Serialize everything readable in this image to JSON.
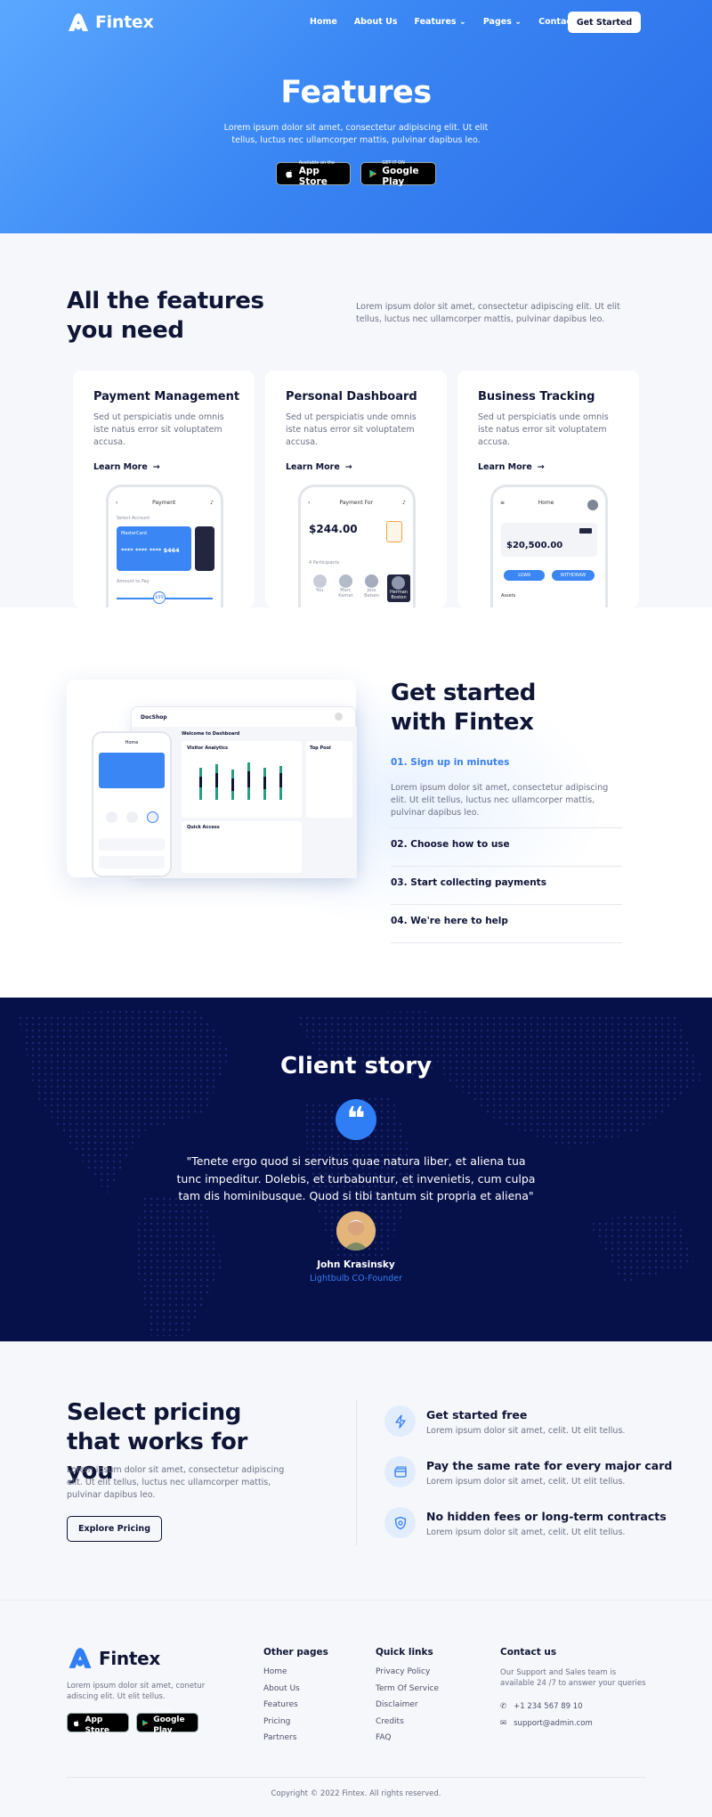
{
  "brand": {
    "name": "Fintex",
    "accent": "#2f7ef5",
    "navy": "#061049"
  },
  "nav": {
    "items": [
      "Home",
      "About Us",
      "Features",
      "Pages",
      "Contact Us"
    ],
    "cta": "Get Started"
  },
  "hero": {
    "title": "Features",
    "subtitle": "Lorem ipsum dolor sit amet, consectetur adipiscing elit. Ut elit tellus, luctus nec ullamcorper mattis, pulvinar dapibus leo.",
    "app_store": {
      "small": "Available on the",
      "big": "App Store"
    },
    "google_play": {
      "small": "GET IT ON",
      "big": "Google Play"
    }
  },
  "features": {
    "title": "All the features you need",
    "intro": "Lorem ipsum dolor sit amet, consectetur adipiscing elit. Ut elit tellus, luctus nec ullamcorper mattis, pulvinar dapibus leo.",
    "learn_more": "Learn More",
    "cards": [
      {
        "title": "Payment Management",
        "text": "Sed ut perspiciatis unde omnis iste natus error sit voluptatem accusa.",
        "phone": {
          "header": "Payment",
          "label1": "Select Account",
          "card_name": "MasterCard",
          "card_num": "**** **** **** $464",
          "label2": "Amount to Pay",
          "amount": "$99"
        }
      },
      {
        "title": "Personal Dashboard",
        "text": "Sed ut perspiciatis unde omnis iste natus error sit voluptatem accusa.",
        "phone": {
          "header": "Payment For",
          "amount": "$244.00",
          "label": "4 Participants",
          "people": [
            "You",
            "Marc Kamat",
            "Jess Belsen",
            "Herman Boston"
          ]
        }
      },
      {
        "title": "Business Tracking",
        "text": "Sed ut perspiciatis unde omnis iste natus error sit voluptatem accusa.",
        "phone": {
          "header": "Home",
          "amount": "$20,500.00",
          "btn1": "LOAN",
          "btn2": "WITHDRAW",
          "label": "Assets"
        }
      }
    ]
  },
  "get_started": {
    "title": "Get started with Fintex",
    "steps": [
      "01. Sign up in minutes",
      "02. Choose how to use",
      "03. Start collecting payments",
      "04. We're here to help"
    ],
    "step_desc": "Lorem ipsum dolor sit amet, consectetur adipiscing elit. Ut elit tellus, luctus nec ullamcorper mattis, pulvinar dapibus leo.",
    "dashboard": {
      "app": "DocShop",
      "welcome": "Welcome to Dashboard",
      "chart_title": "Visitor Analytics",
      "top_title": "Top Pool",
      "quick": "Quick Access",
      "mob_title": "Home"
    }
  },
  "story": {
    "title": "Client story",
    "quote": "\"Tenete ergo quod si servitus quae natura liber, et aliena tua tunc impeditur. Dolebis, et turbabuntur, et invenietis, cum culpa tam dis hominibusque. Quod si tibi tantum sit propria et aliena\"",
    "name": "John Krasinsky",
    "role": "Lightbulb CO-Founder"
  },
  "pricing": {
    "title": "Select pricing that works for you",
    "desc": "Lorem ipsum dolor sit amet, consectetur adipiscing elit. Ut elit tellus, luctus nec ullamcorper mattis, pulvinar dapibus leo.",
    "cta": "Explore Pricing",
    "items": [
      {
        "title": "Get started free",
        "text": "Lorem ipsum dolor sit amet, celit. Ut elit tellus.",
        "icon": "lightning-icon"
      },
      {
        "title": "Pay the same rate for every major card",
        "text": "Lorem ipsum dolor sit amet, celit. Ut elit tellus.",
        "icon": "card-icon"
      },
      {
        "title": "No hidden fees or long-term contracts",
        "text": "Lorem ipsum dolor sit amet, celit. Ut elit tellus.",
        "icon": "shield-icon"
      }
    ]
  },
  "footer": {
    "desc": "Lorem ipsum dolor sit amet, conetur adiscing elit. Ut elit tellus.",
    "other": {
      "title": "Other pages",
      "items": [
        "Home",
        "About Us",
        "Features",
        "Pricing",
        "Partners"
      ]
    },
    "quick": {
      "title": "Quick links",
      "items": [
        "Privacy Policy",
        "Term Of Service",
        "Disclaimer",
        "Credits",
        "FAQ"
      ]
    },
    "contact": {
      "title": "Contact us",
      "text": "Our Support and Sales team is available 24 /7 to answer your queries",
      "phone": "+1 234 567 89 10",
      "email": "support@admin.com"
    },
    "copyright": "Copyright © 2022 Fintex. All rights reserved."
  }
}
